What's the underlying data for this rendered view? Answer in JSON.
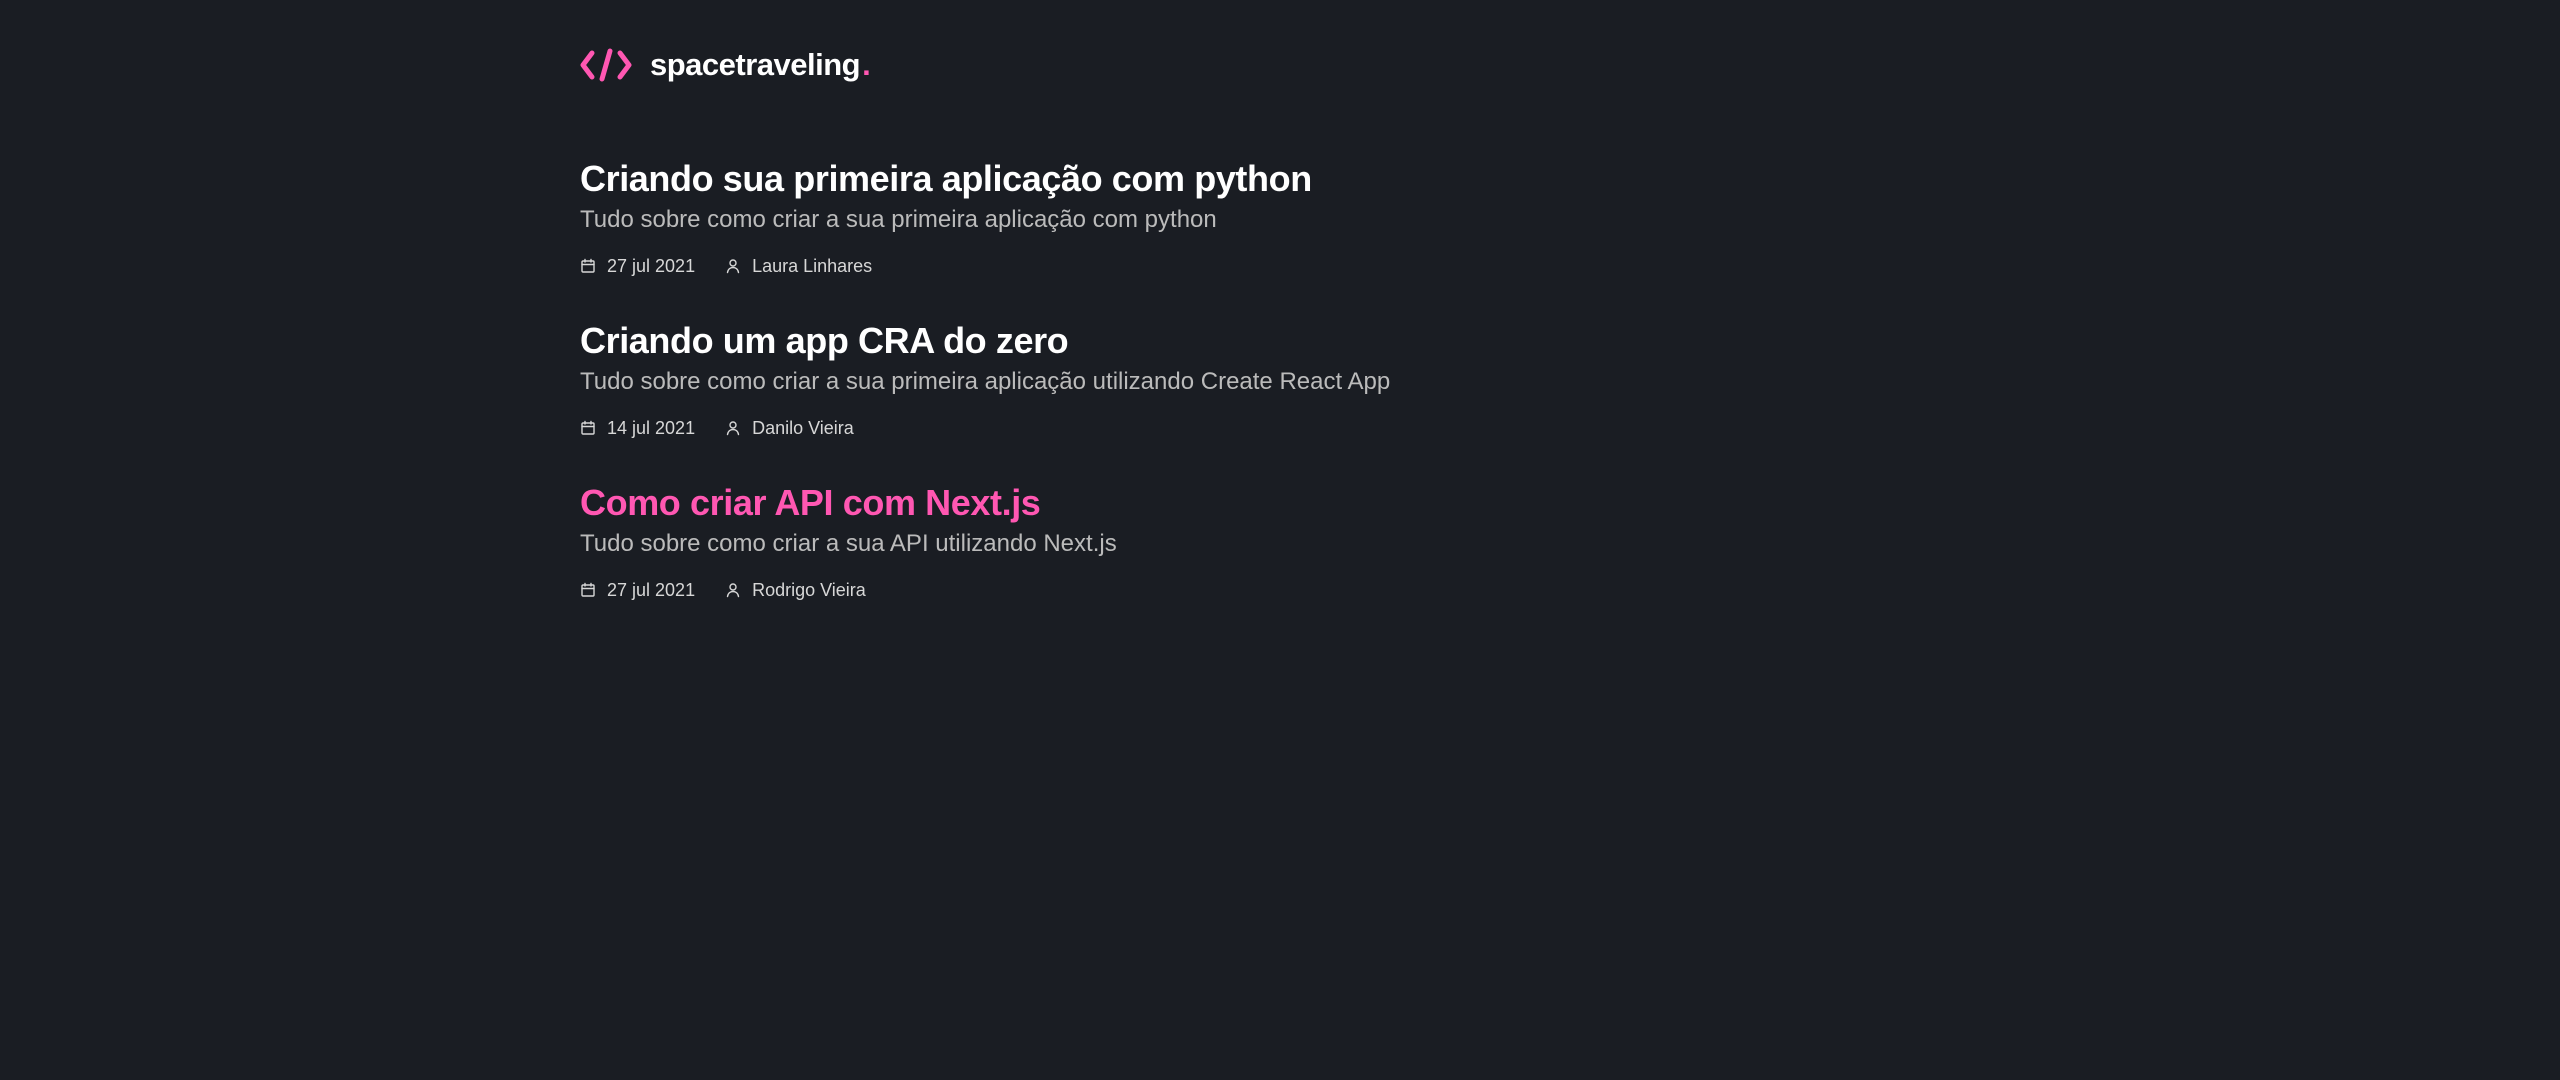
{
  "header": {
    "logo_text": "spacetraveling",
    "logo_dot": ".",
    "logo_icon": "code-brackets-icon"
  },
  "colors": {
    "background": "#1a1d23",
    "accent": "#ff57b2",
    "heading": "#ffffff",
    "subtitle": "#bbbbbb",
    "meta": "#d7d7d7"
  },
  "posts": [
    {
      "title": "Criando sua primeira aplicação com python",
      "subtitle": "Tudo sobre como criar a sua primeira aplicação com python",
      "date": "27 jul 2021",
      "author": "Laura Linhares"
    },
    {
      "title": "Criando um app CRA do zero",
      "subtitle": "Tudo sobre como criar a sua primeira aplicação utilizando Create React App",
      "date": "14 jul 2021",
      "author": "Danilo Vieira"
    },
    {
      "title": "Como criar API com Next.js",
      "subtitle": "Tudo sobre como criar a sua API utilizando Next.js",
      "date": "27 jul 2021",
      "author": "Rodrigo Vieira",
      "highlighted": true
    }
  ]
}
